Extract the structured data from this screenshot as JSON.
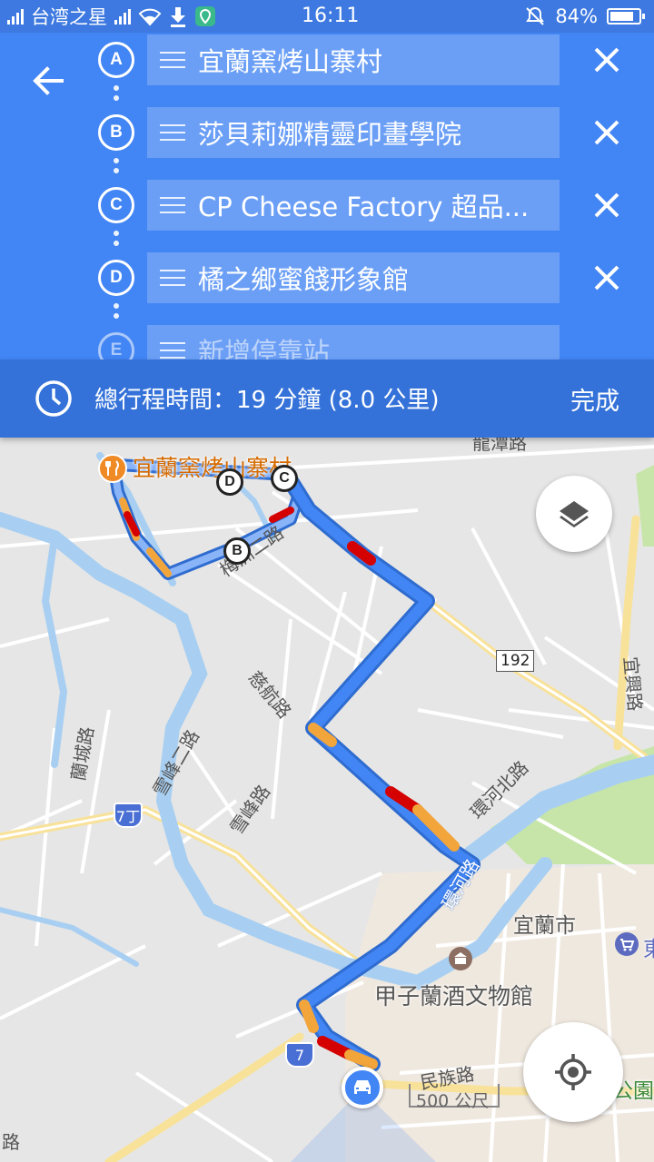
{
  "status_bar": {
    "carrier": "台湾之星",
    "time": "16:11",
    "battery": "84%",
    "battery_level": 0.84
  },
  "directions": {
    "stops": [
      {
        "letter": "A",
        "name": "宜蘭窯烤山寨村"
      },
      {
        "letter": "B",
        "name": "莎貝莉娜精靈印畫學院"
      },
      {
        "letter": "C",
        "name": "CP Cheese Factory 超品..."
      },
      {
        "letter": "D",
        "name": "橘之鄉蜜餞形象館"
      },
      {
        "letter": "E",
        "name": "新增停靠站"
      }
    ]
  },
  "summary": {
    "total": "總行程時間：19 分鐘  (8.0 公里)",
    "done_label": "完成"
  },
  "map": {
    "poi_restaurant": "宜蘭窯烤山寨村",
    "poi_museum": "甲子蘭酒文物館",
    "city": "宜蘭市",
    "roads": {
      "longtan": "龍潭路",
      "meizhou": "梅洲二路",
      "cihang": "慈航路",
      "lancheng": "蘭城路",
      "xuefeng2": "雪峰二路",
      "xuefeng": "雪峰路",
      "huanhe_north": "環河北路",
      "huanhe": "環河路",
      "yixing": "宜興路",
      "minzu": "民族路",
      "partial_left": "路"
    },
    "shields": {
      "r192": "192",
      "r7ding": "7丁",
      "r7": "7"
    },
    "scale": "500 公尺",
    "park_partial": "公園",
    "store_partial": "東",
    "markers": {
      "c": "C",
      "d": "D",
      "b": "B"
    }
  },
  "colors": {
    "header_blue": "#4285f4",
    "summary_blue": "#3472d9",
    "route_blue": "#4285f4",
    "traffic_orange": "#f2a53a",
    "traffic_red": "#d50000"
  }
}
